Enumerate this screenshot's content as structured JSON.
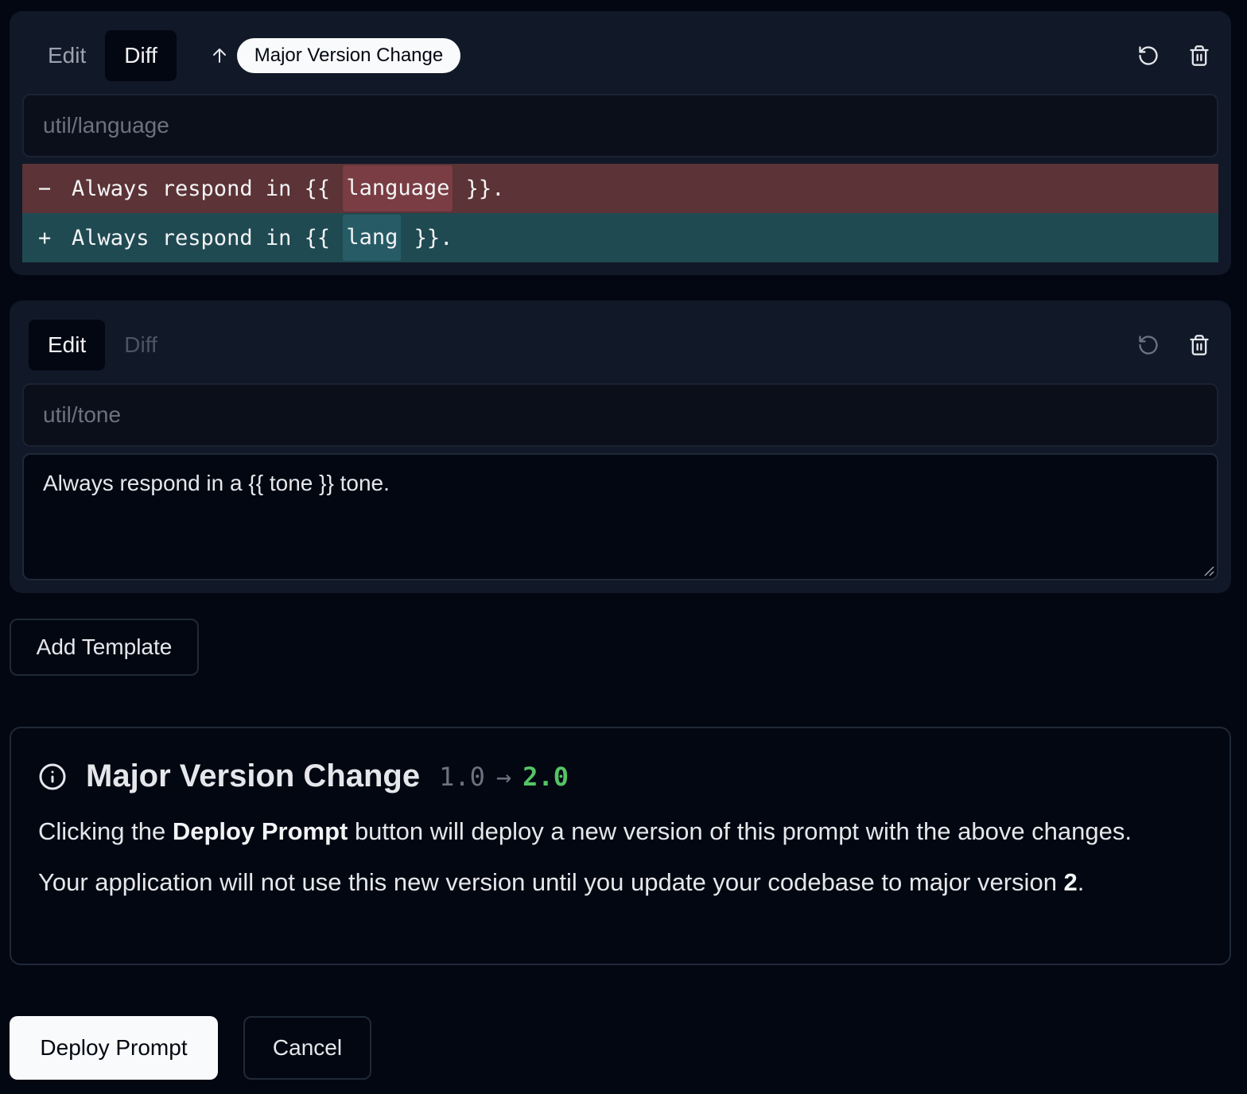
{
  "templates": [
    {
      "tabs": [
        {
          "label": "Edit",
          "active": false
        },
        {
          "label": "Diff",
          "active": true
        }
      ],
      "version_badge": {
        "icon": "arrow-up-icon",
        "label": "Major Version Change"
      },
      "actions": [
        {
          "icon": "undo-icon",
          "label": "Revert"
        },
        {
          "icon": "trash-icon",
          "label": "Delete"
        }
      ],
      "name": "util/language",
      "diff": [
        {
          "type": "removed",
          "sign": "−",
          "before": "Always respond in {{ ",
          "highlight": "language",
          "after": " }}."
        },
        {
          "type": "added",
          "sign": "+",
          "before": "Always respond in {{ ",
          "highlight": "lang",
          "after": " }}."
        }
      ]
    },
    {
      "tabs": [
        {
          "label": "Edit",
          "active": true
        },
        {
          "label": "Diff",
          "active": false
        }
      ],
      "actions": [
        {
          "icon": "undo-icon",
          "label": "Revert"
        },
        {
          "icon": "trash-icon",
          "label": "Delete"
        }
      ],
      "name": "util/tone",
      "content": "Always respond in a {{ tone }} tone."
    }
  ],
  "add_template_label": "Add Template",
  "alert": {
    "icon": "info-icon",
    "title": "Major Version Change",
    "version_from": "1.0",
    "version_arrow": "→",
    "version_to": "2.0",
    "paragraph1_pre": "Clicking the ",
    "paragraph1_bold": "Deploy Prompt",
    "paragraph1_post": " button will deploy a new version of this prompt with the above changes.",
    "paragraph2_pre": "Your application will not use this new version until you update your codebase to major version ",
    "paragraph2_bold": "2",
    "paragraph2_post": "."
  },
  "footer": {
    "deploy_label": "Deploy Prompt",
    "cancel_label": "Cancel"
  },
  "colors": {
    "background": "#030712",
    "card": "#111827",
    "diff_removed": "#5c3336",
    "diff_removed_highlight": "#793d43",
    "diff_added": "#204a52",
    "diff_added_highlight": "#275c66",
    "version_new": "#55c465"
  }
}
